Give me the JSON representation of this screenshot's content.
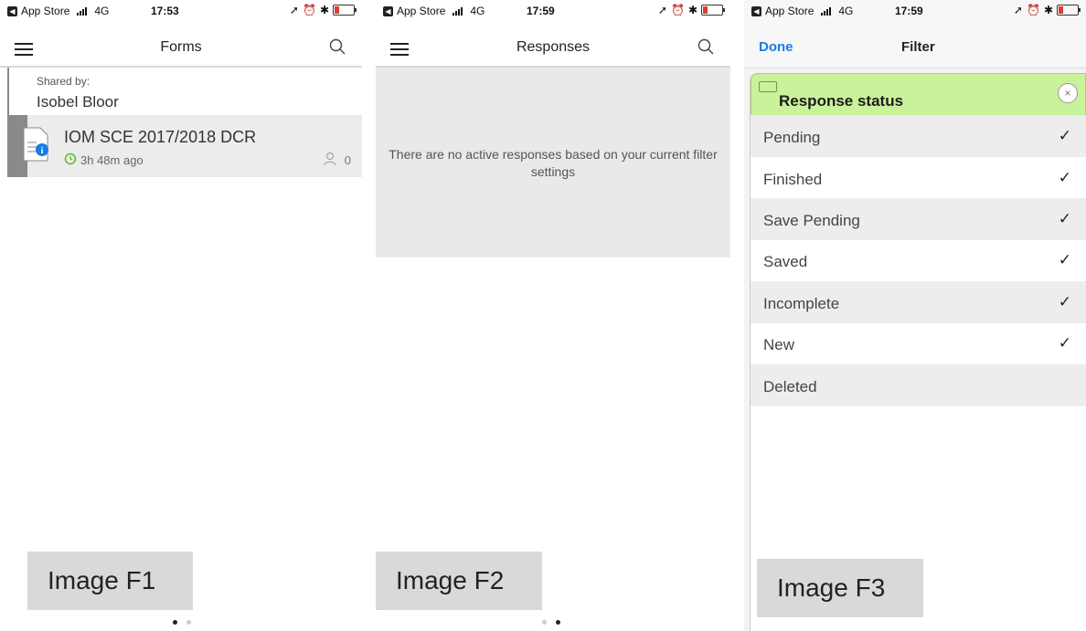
{
  "panels": [
    {
      "status": {
        "carrier": "App Store",
        "network": "4G",
        "time": "17:53"
      },
      "nav": {
        "title": "Forms"
      },
      "shared": {
        "label": "Shared by:",
        "name": "Isobel Bloor"
      },
      "form": {
        "title": "IOM SCE 2017/2018 DCR",
        "age": "3h 48m ago",
        "count": "0"
      },
      "image_label": "Image F1"
    },
    {
      "status": {
        "carrier": "App Store",
        "network": "4G",
        "time": "17:59"
      },
      "nav": {
        "title": "Responses"
      },
      "empty_message": "There are no active responses based on your current filter settings",
      "image_label": "Image F2"
    },
    {
      "status": {
        "carrier": "App Store",
        "network": "4G",
        "time": "17:59"
      },
      "nav": {
        "done": "Done",
        "title": "Filter"
      },
      "filter": {
        "heading": "Response status",
        "close": "×",
        "options": [
          {
            "label": "Pending",
            "checked": "✓"
          },
          {
            "label": "Finished",
            "checked": "✓"
          },
          {
            "label": "Save Pending",
            "checked": "✓"
          },
          {
            "label": "Saved",
            "checked": "✓"
          },
          {
            "label": "Incomplete",
            "checked": "✓"
          },
          {
            "label": "New",
            "checked": "✓"
          },
          {
            "label": "Deleted",
            "checked": ""
          }
        ]
      },
      "image_label": "Image F3"
    }
  ],
  "pager": {
    "pages": 2,
    "active_p1": 1,
    "active_p2": 2
  },
  "colors": {
    "accent": "#1a7ce6",
    "filter_header": "#c9f29b",
    "battery": "#e53935"
  },
  "icons": [
    "hamburger-icon",
    "search-icon",
    "document-info-icon",
    "clock-icon",
    "person-icon",
    "close-icon",
    "tag-icon",
    "check-icon"
  ]
}
